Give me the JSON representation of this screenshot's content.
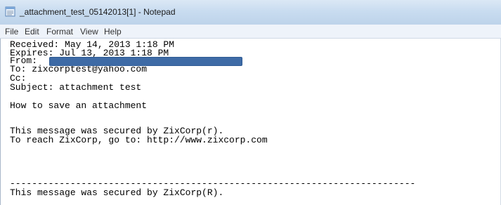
{
  "window": {
    "title": "_attachment_test_05142013[1] - Notepad"
  },
  "menu": {
    "items": [
      "File",
      "Edit",
      "Format",
      "View",
      "Help"
    ]
  },
  "content": {
    "received": "Received: May 14, 2013 1:18 PM",
    "expires": "Expires: Jul 13, 2013 1:18 PM",
    "from": "From:",
    "to": "To: zixcorptest@yahoo.com",
    "cc": "Cc:",
    "subject": "Subject: attachment test",
    "body_line": "How to save an attachment",
    "secured_line": "This message was secured by ZixCorp(r).",
    "reach_line": "To reach ZixCorp, go to: http://www.zixcorp.com",
    "separator": "--------------------------------------------------------------------------",
    "footer_line": "This message was secured by ZixCorp(R)."
  },
  "icons": {
    "app_icon": "notepad-icon"
  },
  "colors": {
    "redaction": "#3e6ba6",
    "titlebar": "#c9dcf0"
  }
}
